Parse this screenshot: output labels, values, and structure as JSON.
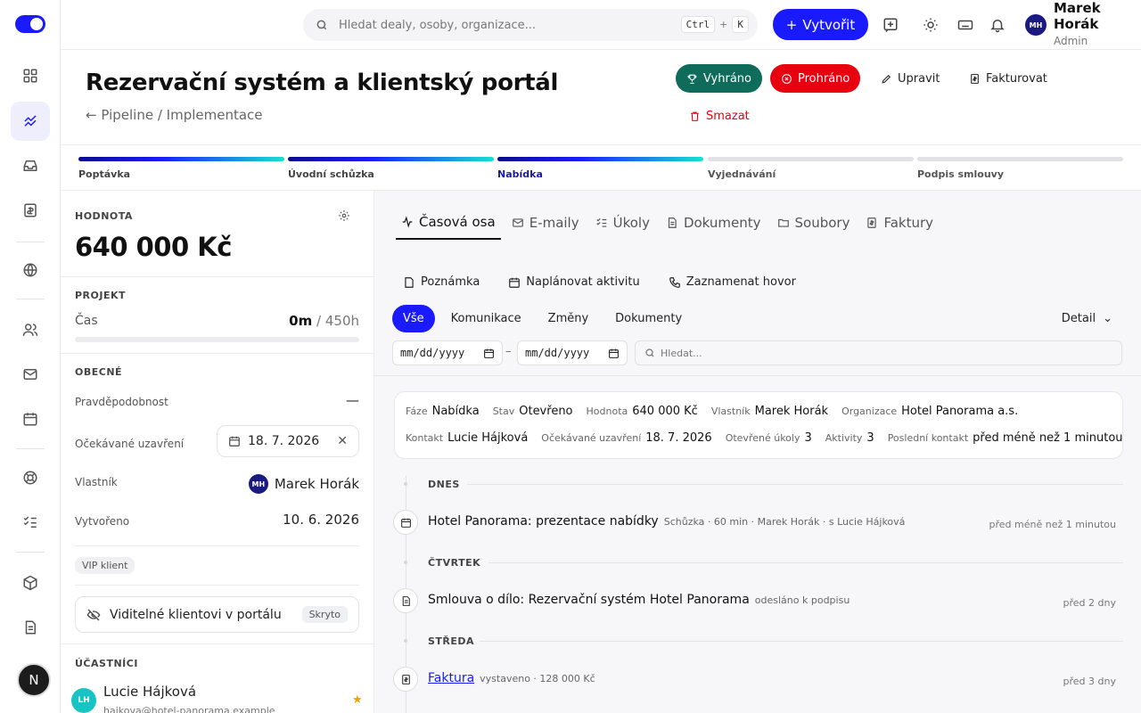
{
  "topbar": {
    "search_placeholder": "Hledat dealy, osoby, organizace...",
    "kbd_ctrl": "Ctrl",
    "kbd_plus": "+",
    "kbd_k": "K",
    "create_label": "Vytvořit",
    "user_initials": "MH",
    "user_name": "Marek Horák",
    "user_role": "Admin",
    "accent": "#1a1aff"
  },
  "rail": {
    "avatar_letter": "N",
    "icons": [
      "dashboard-icon",
      "deals-icon",
      "inbox-icon",
      "invoices-icon",
      "globe-icon",
      "contacts-icon",
      "mail-icon",
      "calendar-icon",
      "support-icon",
      "tasks-icon",
      "products-icon",
      "documents-icon"
    ]
  },
  "header": {
    "title": "Rezervační systém a klientský portál",
    "breadcrumb": "Pipeline / Implementace",
    "won_label": "Vyhráno",
    "lost_label": "Prohráno",
    "edit_label": "Upravit",
    "invoice_label": "Fakturovat",
    "delete_label": "Smazat",
    "won_color": "#0f6b5a",
    "lost_color": "#e8000e"
  },
  "stages": [
    {
      "label": "Poptávka",
      "state": "done"
    },
    {
      "label": "Úvodní schůzka",
      "state": "done"
    },
    {
      "label": "Nabídka",
      "state": "current"
    },
    {
      "label": "Vyjednávání",
      "state": "todo"
    },
    {
      "label": "Podpis smlouvy",
      "state": "todo"
    }
  ],
  "left": {
    "value_title": "HODNOTA",
    "value": "640 000 Kč",
    "project_title": "PROJEKT",
    "time_label": "Čas",
    "time_spent": "0m",
    "time_total": "/ 450h",
    "time_progress": 0,
    "general_title": "OBECNÉ",
    "probability_label": "Pravděpodobnost",
    "probability_value": "—",
    "expected_close_label": "Očekávané uzavření",
    "expected_close_value": "18. 7. 2026",
    "owner_label": "Vlastník",
    "owner_initials": "MH",
    "owner_name": "Marek Horák",
    "created_label": "Vytvořeno",
    "created_value": "10. 6. 2026",
    "tag": "VIP klient",
    "visible_label": "Viditelné klientovi v portálu",
    "visible_badge": "Skryto",
    "participants_title": "ÚČASTNÍCI",
    "participant_initials": "LH",
    "participant_name": "Lucie Hájková",
    "participant_email": "hajkova@hotel-panorama.example"
  },
  "right": {
    "tabs": [
      "Časová osa",
      "E-maily",
      "Úkoly",
      "Dokumenty",
      "Soubory",
      "Faktury"
    ],
    "actions": [
      "Poznámka",
      "Naplánovat aktivitu",
      "Zaznamenat hovor"
    ],
    "filters": [
      "Vše",
      "Komunikace",
      "Změny",
      "Dokumenty"
    ],
    "detail_label": "Detail",
    "date_placeholder": "mm/dd/yyyy",
    "date_dash": "–",
    "search_placeholder": "Hledat...",
    "summary": {
      "phase_k": "Fáze",
      "phase_v": "Nabídka",
      "status_k": "Stav",
      "status_v": "Otevřeno",
      "value_k": "Hodnota",
      "value_v": "640 000 Kč",
      "owner_k": "Vlastník",
      "owner_v": "Marek Horák",
      "org_k": "Organizace",
      "org_v": "Hotel Panorama a.s.",
      "contact_k": "Kontakt",
      "contact_v": "Lucie Hájková",
      "close_k": "Očekávané uzavření",
      "close_v": "18. 7. 2026",
      "tasks_k": "Otevřené úkoly",
      "tasks_v": "3",
      "activities_k": "Aktivity",
      "activities_v": "3",
      "last_k": "Poslední kontakt",
      "last_v": "před méně než 1 minutou"
    },
    "timeline": [
      {
        "day": "DNES",
        "title": "Hotel Panorama: prezentace nabídky",
        "sub": "Schůzka · 60 min · Marek Horák · s Lucie Hájková",
        "time": "před méně než 1 minutou",
        "icon": "calendar-icon"
      },
      {
        "day": "ČTVRTEK",
        "title": "Smlouva o dílo: Rezervační systém Hotel Panorama",
        "sub": "odesláno k podpisu",
        "time": "před 2 dny",
        "icon": "document-icon"
      },
      {
        "day": "STŘEDA",
        "title": "Faktura",
        "sub": "vystaveno · 128 000 Kč",
        "time": "před 3 dny",
        "icon": "invoice-icon"
      }
    ]
  }
}
